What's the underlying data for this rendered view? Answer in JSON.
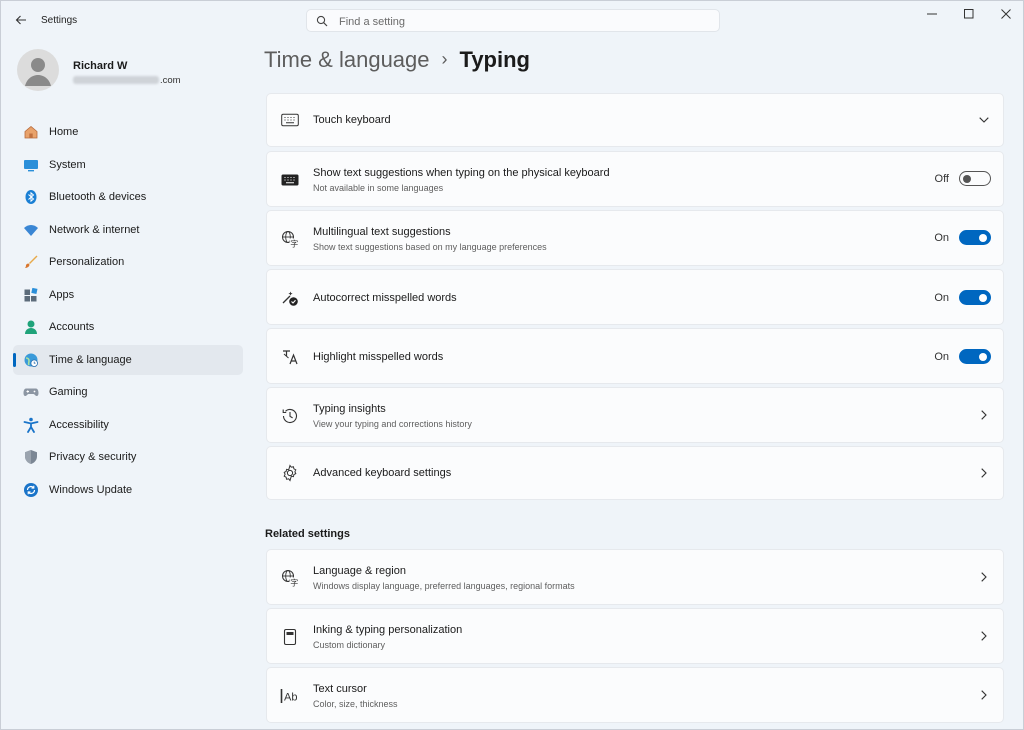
{
  "app": {
    "title": "Settings"
  },
  "search": {
    "placeholder": "Find a setting"
  },
  "user": {
    "name": "Richard W",
    "email_suffix": ".com"
  },
  "sidebar": {
    "items": [
      {
        "label": "Home",
        "icon": "home-icon"
      },
      {
        "label": "System",
        "icon": "system-icon"
      },
      {
        "label": "Bluetooth & devices",
        "icon": "bluetooth-icon"
      },
      {
        "label": "Network & internet",
        "icon": "wifi-icon"
      },
      {
        "label": "Personalization",
        "icon": "brush-icon"
      },
      {
        "label": "Apps",
        "icon": "apps-icon"
      },
      {
        "label": "Accounts",
        "icon": "accounts-icon"
      },
      {
        "label": "Time & language",
        "icon": "globe-clock-icon",
        "active": true
      },
      {
        "label": "Gaming",
        "icon": "gamepad-icon"
      },
      {
        "label": "Accessibility",
        "icon": "accessibility-icon"
      },
      {
        "label": "Privacy & security",
        "icon": "shield-icon"
      },
      {
        "label": "Windows Update",
        "icon": "update-icon"
      }
    ]
  },
  "breadcrumb": {
    "parent": "Time & language",
    "separator": "›",
    "current": "Typing"
  },
  "settings": {
    "touch_keyboard": {
      "title": "Touch keyboard",
      "icon": "keyboard-icon"
    },
    "text_suggestions": {
      "title": "Show text suggestions when typing on the physical keyboard",
      "subtitle": "Not available in some languages",
      "state_label": "Off",
      "enabled": false,
      "icon": "keyboard-filled-icon"
    },
    "multilingual": {
      "title": "Multilingual text suggestions",
      "subtitle": "Show text suggestions based on my language preferences",
      "state_label": "On",
      "enabled": true,
      "icon": "language-icon"
    },
    "autocorrect": {
      "title": "Autocorrect misspelled words",
      "state_label": "On",
      "enabled": true,
      "icon": "autocorrect-icon"
    },
    "highlight": {
      "title": "Highlight misspelled words",
      "state_label": "On",
      "enabled": true,
      "icon": "highlight-spelling-icon"
    },
    "typing_insights": {
      "title": "Typing insights",
      "subtitle": "View your typing and corrections history",
      "icon": "history-icon"
    },
    "advanced_keyboard": {
      "title": "Advanced keyboard settings",
      "icon": "gear-icon"
    }
  },
  "related": {
    "heading": "Related settings",
    "language_region": {
      "title": "Language & region",
      "subtitle": "Windows display language, preferred languages, regional formats",
      "icon": "language-icon"
    },
    "inking": {
      "title": "Inking & typing personalization",
      "subtitle": "Custom dictionary",
      "icon": "notebook-icon"
    },
    "text_cursor": {
      "title": "Text cursor",
      "subtitle": "Color, size, thickness",
      "icon": "text-cursor-icon"
    }
  },
  "colors": {
    "accent": "#0067c0",
    "background": "#eff4f9",
    "card": "#fbfcfd"
  }
}
